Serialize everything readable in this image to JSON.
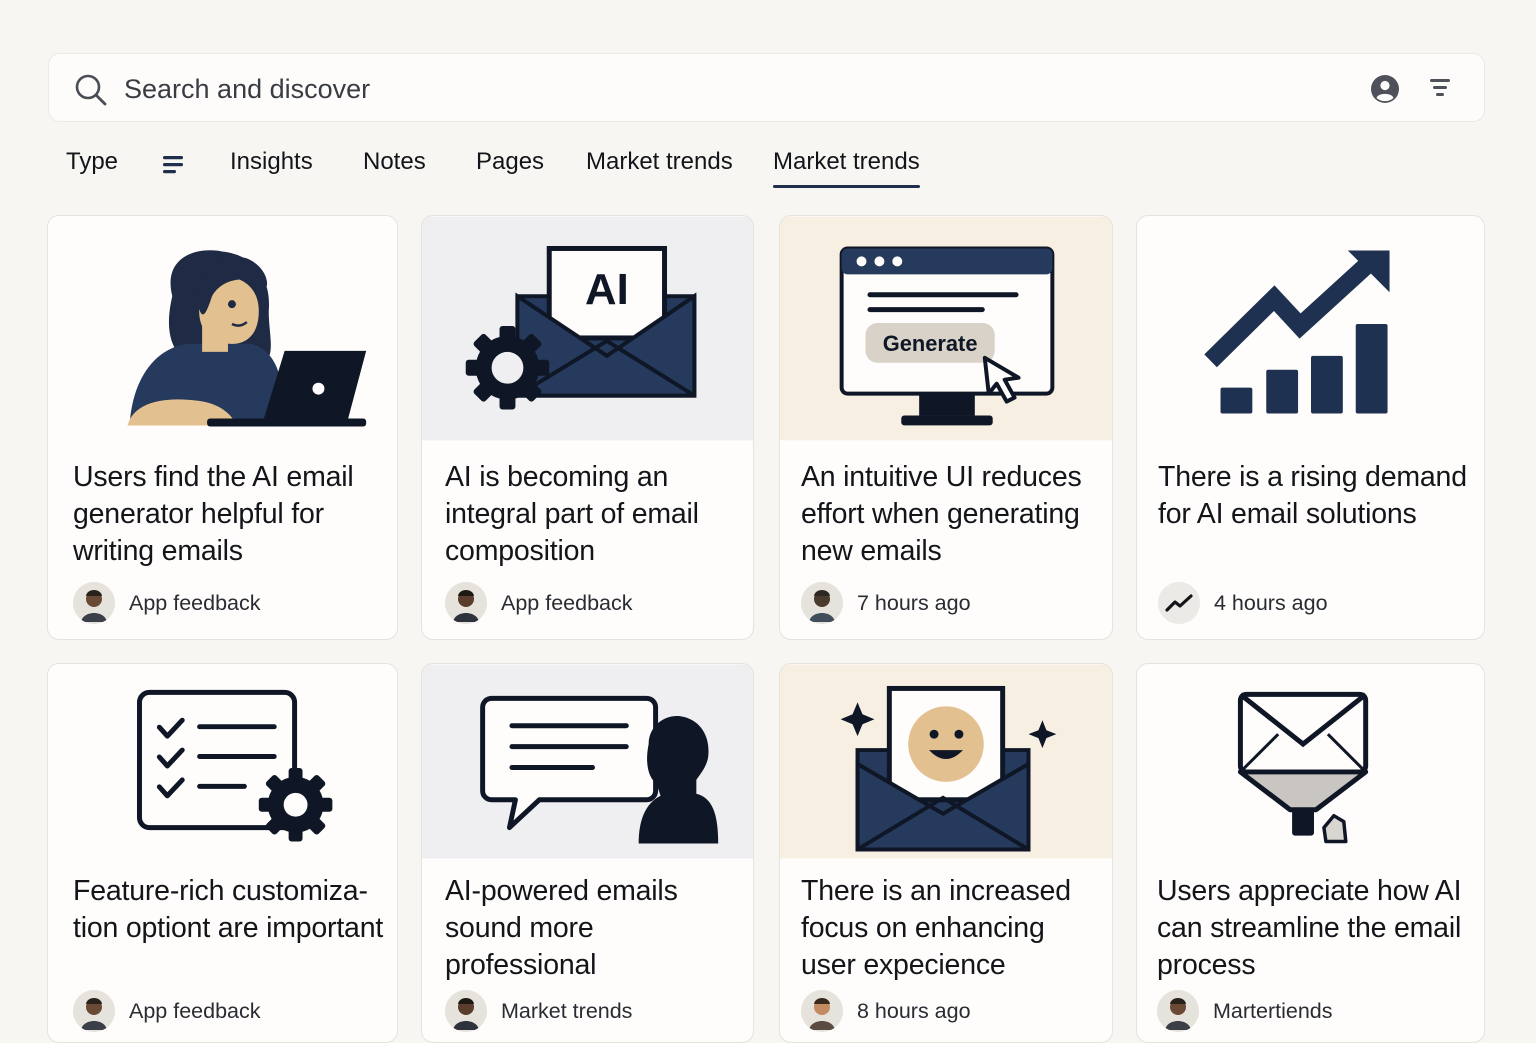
{
  "search": {
    "placeholder": "Search and discover"
  },
  "tabs": [
    {
      "label": "Type"
    },
    {
      "label": "Insights"
    },
    {
      "label": "Notes"
    },
    {
      "label": "Pages"
    },
    {
      "label": "Market trends"
    },
    {
      "label": "Market trends",
      "active": true
    }
  ],
  "cards": [
    {
      "title": "Users find the AI email generator helpful for writing emails",
      "meta": "App feedback",
      "illustration": "woman-laptop-icon"
    },
    {
      "title": "AI is becoming an integral part of email composition",
      "meta": "App feedback",
      "illustration": "ai-envelope-gear-icon"
    },
    {
      "title": "An intuitive UI reduces effort when generating new emails",
      "meta": "7 hours ago",
      "illustration": "monitor-generate-icon",
      "button_label": "Generate"
    },
    {
      "title": "There is a rising demand for AI email solutions",
      "meta": "4 hours ago",
      "illustration": "rising-bar-chart-icon"
    },
    {
      "title": "Feature-rich customiza-tion optiont are important",
      "meta": "App feedback",
      "illustration": "checklist-gear-icon"
    },
    {
      "title": "AI-powered emails sound more professional",
      "meta": "Market trends",
      "illustration": "speech-bubble-person-icon"
    },
    {
      "title": "There is an increased focus on enhancing user expecience",
      "meta": "8 hours ago",
      "illustration": "smiley-envelope-icon"
    },
    {
      "title": "Users appreciate how AI can streamline the email process",
      "meta": "Martertiends",
      "illustration": "envelope-funnel-icon"
    }
  ],
  "colors": {
    "navy": "#1f3150",
    "dark": "#14151a",
    "skin": "#e3c08f",
    "cream": "#f8efe3",
    "grey_panel": "#efeef0"
  }
}
